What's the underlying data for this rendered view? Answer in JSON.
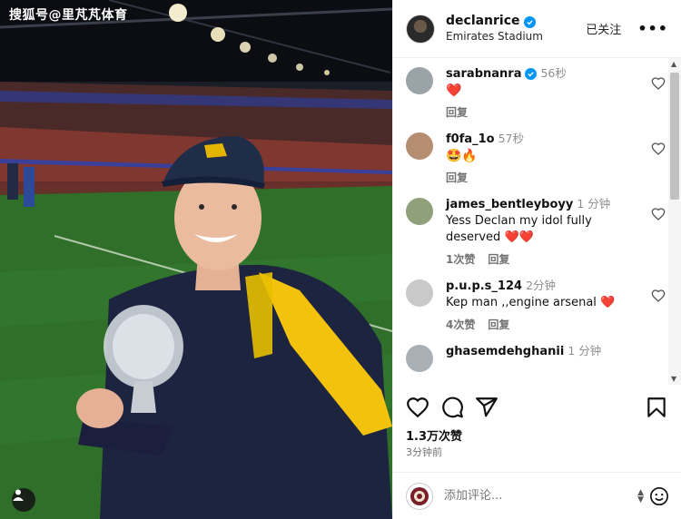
{
  "watermark": "搜狐号@里芃芃体育",
  "post": {
    "username": "declanrice",
    "location": "Emirates Stadium",
    "follow_label": "已关注",
    "more_label": "•••",
    "likes": "1.3万次赞",
    "time_ago": "3分钟前"
  },
  "comments": [
    {
      "user": "sarabnanra",
      "verified": true,
      "time": "56秒",
      "text": "",
      "emojis": "❤️",
      "meta": [
        "回复"
      ],
      "avatar_color": "#9aa3a8"
    },
    {
      "user": "f0fa_1o",
      "verified": false,
      "time": "57秒",
      "text": "",
      "emojis": "🤩🔥",
      "meta": [
        "回复"
      ],
      "avatar_color": "#b58d70"
    },
    {
      "user": "james_bentleyboyy",
      "verified": false,
      "time": "1 分钟",
      "text": "Yess Declan my idol fully deserved ❤️❤️",
      "emojis": "",
      "meta": [
        "1次赞",
        "回复"
      ],
      "avatar_color": "#8fa07a"
    },
    {
      "user": "p.u.p.s_124",
      "verified": false,
      "time": "2分钟",
      "text": "Kep man ,,engine arsenal ❤️",
      "emojis": "",
      "meta": [
        "4次赞",
        "回复"
      ],
      "avatar_color": "#c9c9c9"
    },
    {
      "user": "ghasemdehghanii",
      "verified": false,
      "time": "1 分钟",
      "text": "",
      "emojis": "",
      "meta": [],
      "avatar_color": "#a8b0b6"
    }
  ],
  "add_comment": {
    "placeholder": "添加评论..."
  },
  "icons": {
    "verified": "verified-badge-icon",
    "like": "heart-icon",
    "comment": "comment-icon",
    "share": "share-icon",
    "save": "bookmark-icon",
    "emoji": "emoji-icon",
    "user_tag": "user-tag-icon"
  },
  "colors": {
    "verified_blue": "#0095f6",
    "heart_red": "#ed1c2e",
    "muted_text": "#737373"
  }
}
